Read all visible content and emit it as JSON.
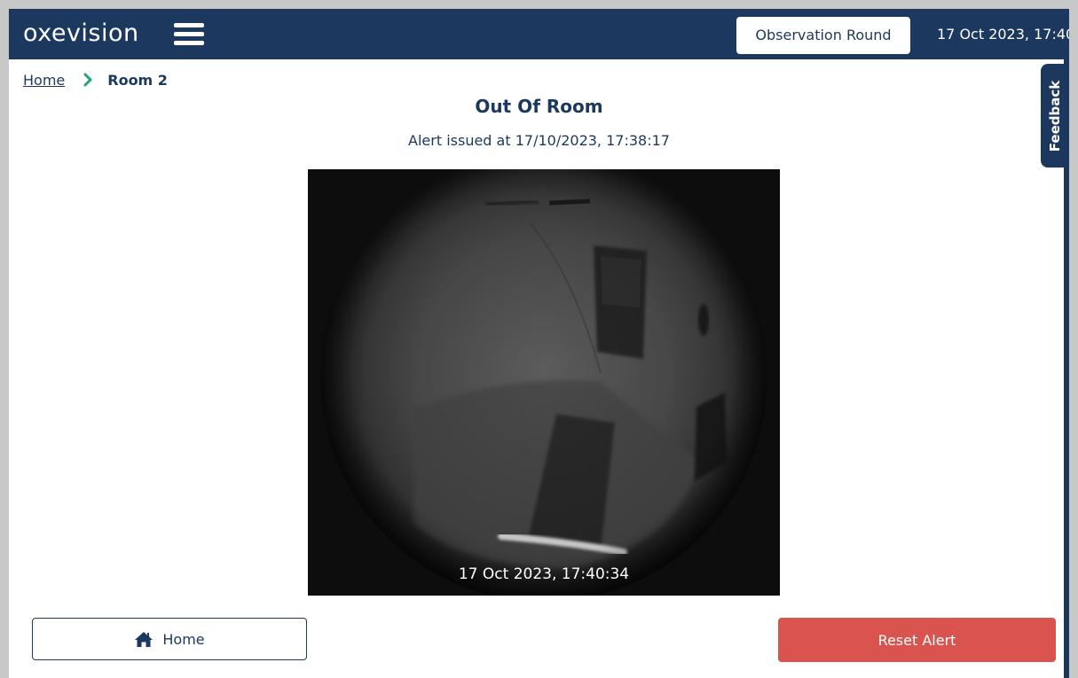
{
  "app": {
    "logo_text": "oxevision",
    "accent_color": "#1d385e",
    "danger_color": "#d9534f",
    "breadcrumb_sep_color": "#1fa37a"
  },
  "header": {
    "menu_icon": "hamburger-icon",
    "observation_round_label": "Observation Round",
    "datetime": "17 Oct 2023, 17:40"
  },
  "feedback": {
    "label": "Feedback"
  },
  "breadcrumb": {
    "home_label": "Home",
    "separator_icon": "chevron-right-icon",
    "current_label": "Room 2"
  },
  "alert": {
    "title": "Out Of Room",
    "issued_text": "Alert issued at 17/10/2023, 17:38:17"
  },
  "camera": {
    "timestamp": "17 Oct 2023, 17:40:34"
  },
  "actions": {
    "home_label": "Home",
    "home_icon": "house-icon",
    "reset_label": "Reset Alert"
  }
}
